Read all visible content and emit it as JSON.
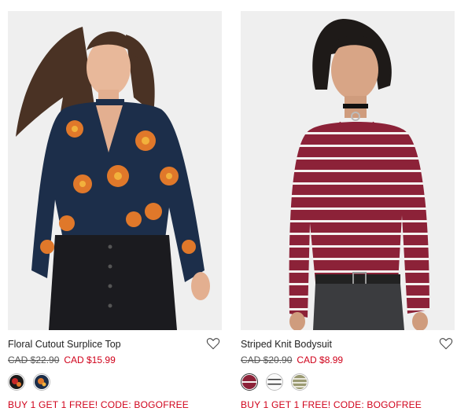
{
  "products": [
    {
      "name": "Floral Cutout Surplice Top",
      "old_price": "CAD $22.90",
      "sale_price": "CAD $15.99",
      "promo": "BUY 1 GET 1 FREE! CODE: BOGOFREE",
      "swatches": [
        "black-floral",
        "navy-floral"
      ]
    },
    {
      "name": "Striped Knit Bodysuit",
      "old_price": "CAD $20.90",
      "sale_price": "CAD $8.99",
      "promo": "BUY 1 GET 1 FREE! CODE: BOGOFREE",
      "swatches": [
        "burgundy-stripe",
        "white-black-stripe",
        "olive-stripe"
      ]
    }
  ],
  "colors": {
    "sale": "#d0021b",
    "navy": "#1c2e4a",
    "burgundy": "#8c2238",
    "orange": "#e0782a"
  }
}
